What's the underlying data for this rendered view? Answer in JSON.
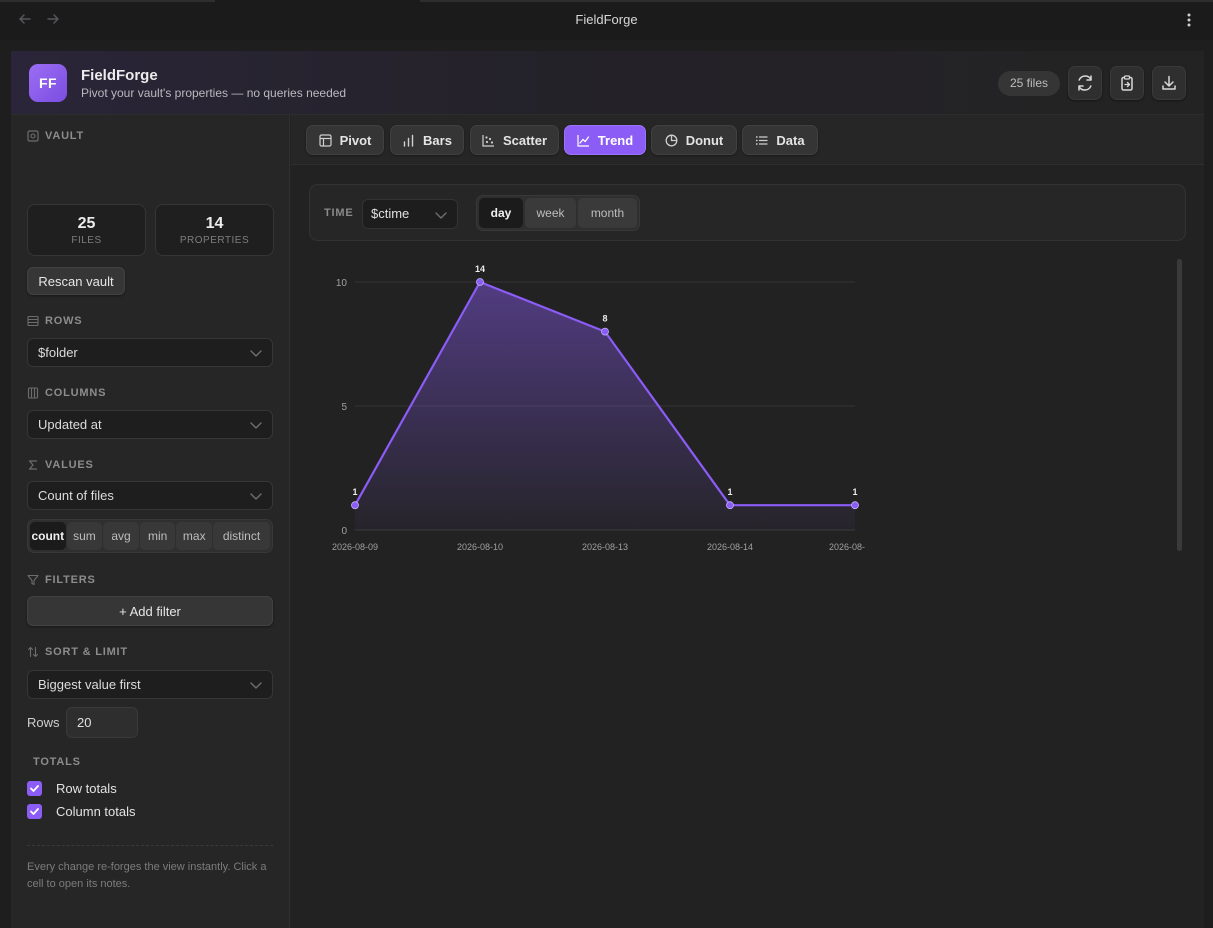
{
  "window": {
    "title": "FieldForge"
  },
  "header": {
    "logo_text": "FF",
    "app_name": "FieldForge",
    "subtitle": "Pivot your vault's properties — no queries needed",
    "file_count": "25 files",
    "actions": [
      "refresh-icon",
      "clipboard-icon",
      "download-icon"
    ]
  },
  "sidebar": {
    "vault": {
      "label": "VAULT",
      "files_value": "25",
      "files_label": "FILES",
      "properties_value": "14",
      "properties_label": "PROPERTIES",
      "rescan_label": "Rescan vault"
    },
    "rows": {
      "label": "ROWS",
      "value": "$folder"
    },
    "columns": {
      "label": "COLUMNS",
      "value": "Updated at"
    },
    "values": {
      "label": "VALUES",
      "value": "Count of files",
      "aggregations": [
        "count",
        "sum",
        "avg",
        "min",
        "max",
        "distinct"
      ],
      "selected_aggregation": "count"
    },
    "filters": {
      "label": "FILTERS",
      "add_label": "+ Add filter"
    },
    "sort_limit": {
      "label": "SORT & LIMIT",
      "value": "Biggest value first",
      "rows_label": "Rows",
      "rows_value": "20"
    },
    "totals": {
      "label": "TOTALS",
      "row_totals": "Row totals",
      "column_totals": "Column totals",
      "row_totals_checked": true,
      "column_totals_checked": true
    },
    "footnote": "Every change re-forges the view instantly. Click a cell to open its notes."
  },
  "tabs": [
    {
      "label": "Pivot",
      "icon": "table-icon"
    },
    {
      "label": "Bars",
      "icon": "bar-chart-icon"
    },
    {
      "label": "Scatter",
      "icon": "scatter-icon"
    },
    {
      "label": "Trend",
      "icon": "line-chart-icon"
    },
    {
      "label": "Donut",
      "icon": "donut-icon"
    },
    {
      "label": "Data",
      "icon": "list-icon"
    }
  ],
  "active_tab": "Trend",
  "time_controls": {
    "label": "TIME",
    "field": "$ctime",
    "granularities": [
      "day",
      "week",
      "month"
    ],
    "selected_granularity": "day"
  },
  "colors": {
    "accent": "#8b5cf6",
    "background": "#1e1e1e"
  },
  "chart_data": {
    "type": "area",
    "x": [
      "2026-08-09",
      "2026-08-10",
      "2026-08-13",
      "2026-08-14",
      "2026-08-"
    ],
    "values": [
      1,
      14,
      8,
      1,
      1
    ],
    "y_ticks": [
      "0",
      "5",
      "10"
    ],
    "ylim": [
      0,
      10
    ],
    "grid": true,
    "color": "#8b5cf6"
  }
}
